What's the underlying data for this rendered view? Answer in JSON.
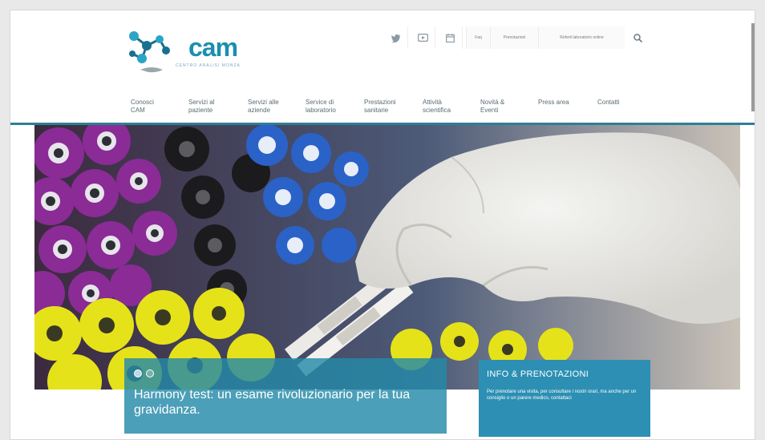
{
  "brand": {
    "logo_text": "cam",
    "tagline": "CENTRO ANALISI MONZA",
    "colors": {
      "primary": "#1a8fb0",
      "nav_rule": "#2d7f95",
      "info_box": "#2c8fb3"
    }
  },
  "top_bar": {
    "social_icons": [
      "twitter-icon",
      "youtube-icon",
      "calendar-icon"
    ],
    "links": [
      "Faq",
      "Prenotazioni",
      "Referti laboratorio online"
    ],
    "search_icon": "search-icon"
  },
  "nav": {
    "items": [
      {
        "line1": "Conosci",
        "line2": "CAM"
      },
      {
        "line1": "Servizi al",
        "line2": "paziente"
      },
      {
        "line1": "Servizi alle",
        "line2": "aziende"
      },
      {
        "line1": "Service di",
        "line2": "laboratorio"
      },
      {
        "line1": "Prestazioni",
        "line2": "sanitarie"
      },
      {
        "line1": "Attività",
        "line2": "scientifica"
      },
      {
        "line1": "Novità &",
        "line2": "Eventi"
      },
      {
        "line1": "Press area",
        "line2": ""
      },
      {
        "line1": "Contatti",
        "line2": ""
      }
    ]
  },
  "hero": {
    "caption_title": "Harmony test: un esame rivoluzionario per la tua gravidanza.",
    "active_dot": 0
  },
  "info_box": {
    "title": "INFO & PRENOTAZIONI",
    "text": "Per prenotare una visita, per consultare i nostri orari, ma anche per un consiglio o un parere medico, contattaci"
  }
}
